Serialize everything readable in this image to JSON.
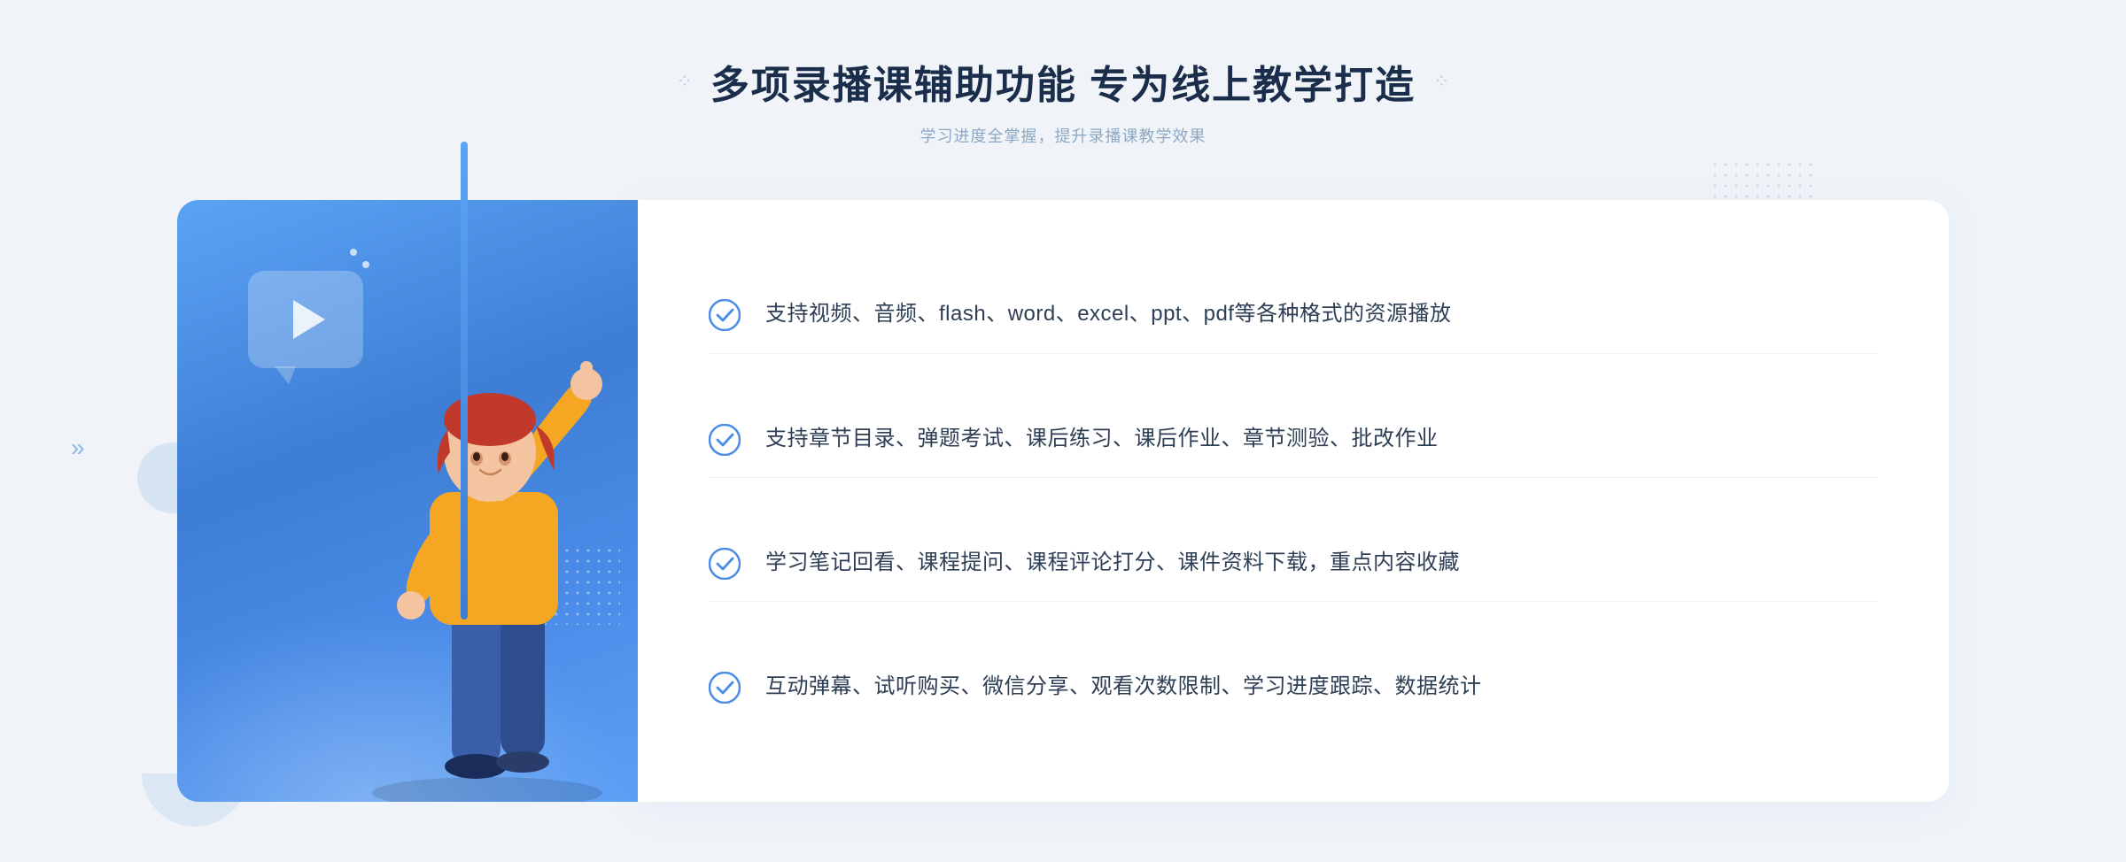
{
  "header": {
    "title": "多项录播课辅助功能 专为线上教学打造",
    "subtitle": "学习进度全掌握，提升录播课教学效果",
    "title_deco_left": "⁘",
    "title_deco_right": "⁘"
  },
  "features": [
    {
      "id": 1,
      "text": "支持视频、音频、flash、word、excel、ppt、pdf等各种格式的资源播放"
    },
    {
      "id": 2,
      "text": "支持章节目录、弹题考试、课后练习、课后作业、章节测验、批改作业"
    },
    {
      "id": 3,
      "text": "学习笔记回看、课程提问、课程评论打分、课件资料下载，重点内容收藏"
    },
    {
      "id": 4,
      "text": "互动弹幕、试听购买、微信分享、观看次数限制、学习进度跟踪、数据统计"
    }
  ],
  "colors": {
    "blue_primary": "#4a8ce8",
    "blue_light": "#5ba3f5",
    "text_dark": "#1a2d4a",
    "text_mid": "#2d3e55",
    "text_light": "#8ea8c3"
  }
}
